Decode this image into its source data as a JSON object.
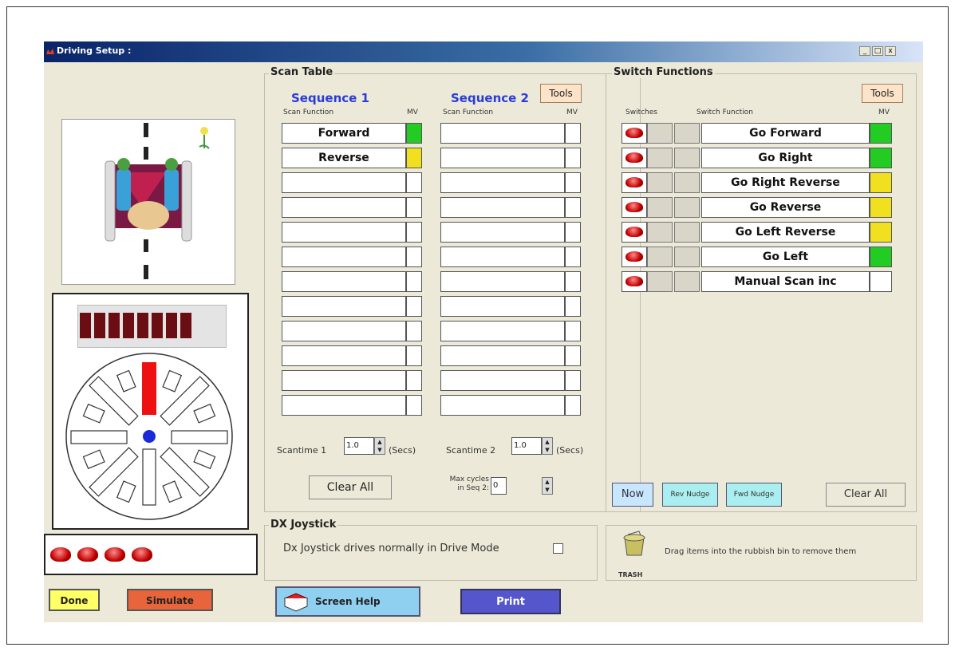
{
  "window": {
    "title": "Driving Setup :",
    "minimize": "_",
    "maximize": "□",
    "close": "x"
  },
  "scan_table": {
    "title": "Scan Table",
    "tools_label": "Tools",
    "seq1_heading": "Sequence 1",
    "seq2_heading": "Sequence 2",
    "col_scan_function": "Scan Function",
    "col_mv": "MV",
    "seq1_rows": [
      {
        "label": "Forward",
        "mv_color": "#22cc22"
      },
      {
        "label": "Reverse",
        "mv_color": "#f0e020"
      },
      {
        "label": "",
        "mv_color": "#ffffff"
      },
      {
        "label": "",
        "mv_color": "#ffffff"
      },
      {
        "label": "",
        "mv_color": "#ffffff"
      },
      {
        "label": "",
        "mv_color": "#ffffff"
      },
      {
        "label": "",
        "mv_color": "#ffffff"
      },
      {
        "label": "",
        "mv_color": "#ffffff"
      },
      {
        "label": "",
        "mv_color": "#ffffff"
      },
      {
        "label": "",
        "mv_color": "#ffffff"
      },
      {
        "label": "",
        "mv_color": "#ffffff"
      },
      {
        "label": "",
        "mv_color": "#ffffff"
      }
    ],
    "seq2_rows": [
      "",
      "",
      "",
      "",
      "",
      "",
      "",
      "",
      "",
      "",
      "",
      ""
    ],
    "scantime1_label": "Scantime 1",
    "scantime1_value": "1.0",
    "scantime2_label": "Scantime 2",
    "scantime2_value": "1.0",
    "secs_label": "(Secs)",
    "clear_all_label": "Clear All",
    "max_cycles_label": "Max cycles in Seq 2:",
    "max_cycles_value": "0"
  },
  "switch_functions": {
    "title": "Switch Functions",
    "tools_label": "Tools",
    "col_switches": "Switches",
    "col_switch_function": "Switch Function",
    "col_mv": "MV",
    "rows": [
      {
        "label": "Go Forward",
        "mv_color": "#22cc22"
      },
      {
        "label": "Go Right",
        "mv_color": "#22cc22"
      },
      {
        "label": "Go Right Reverse",
        "mv_color": "#f0e020"
      },
      {
        "label": "Go Reverse",
        "mv_color": "#f0e020"
      },
      {
        "label": "Go Left Reverse",
        "mv_color": "#f0e020"
      },
      {
        "label": "Go Left",
        "mv_color": "#22cc22"
      },
      {
        "label": "Manual Scan inc",
        "mv_color": "#ffffff"
      }
    ],
    "now_label": "Now",
    "rev_nudge_label": "Rev Nudge",
    "fwd_nudge_label": "Fwd Nudge",
    "clear_all_label": "Clear All"
  },
  "joystick": {
    "title": "DX Joystick",
    "checkbox_label": "Dx Joystick drives normally in Drive Mode",
    "checked": false
  },
  "trash": {
    "icon_label": "TRASH",
    "hint": "Drag items into the rubbish bin to remove them"
  },
  "bottom_buttons": {
    "done": "Done",
    "simulate": "Simulate",
    "screen_help": "Screen Help",
    "print": "Print"
  },
  "colors": {
    "green": "#22cc22",
    "yellow": "#f0e020",
    "tools": "#fde3c8",
    "print": "#5555cc",
    "done": "#ffff66",
    "simulate": "#e8643a",
    "help": "#8fd0f0"
  }
}
